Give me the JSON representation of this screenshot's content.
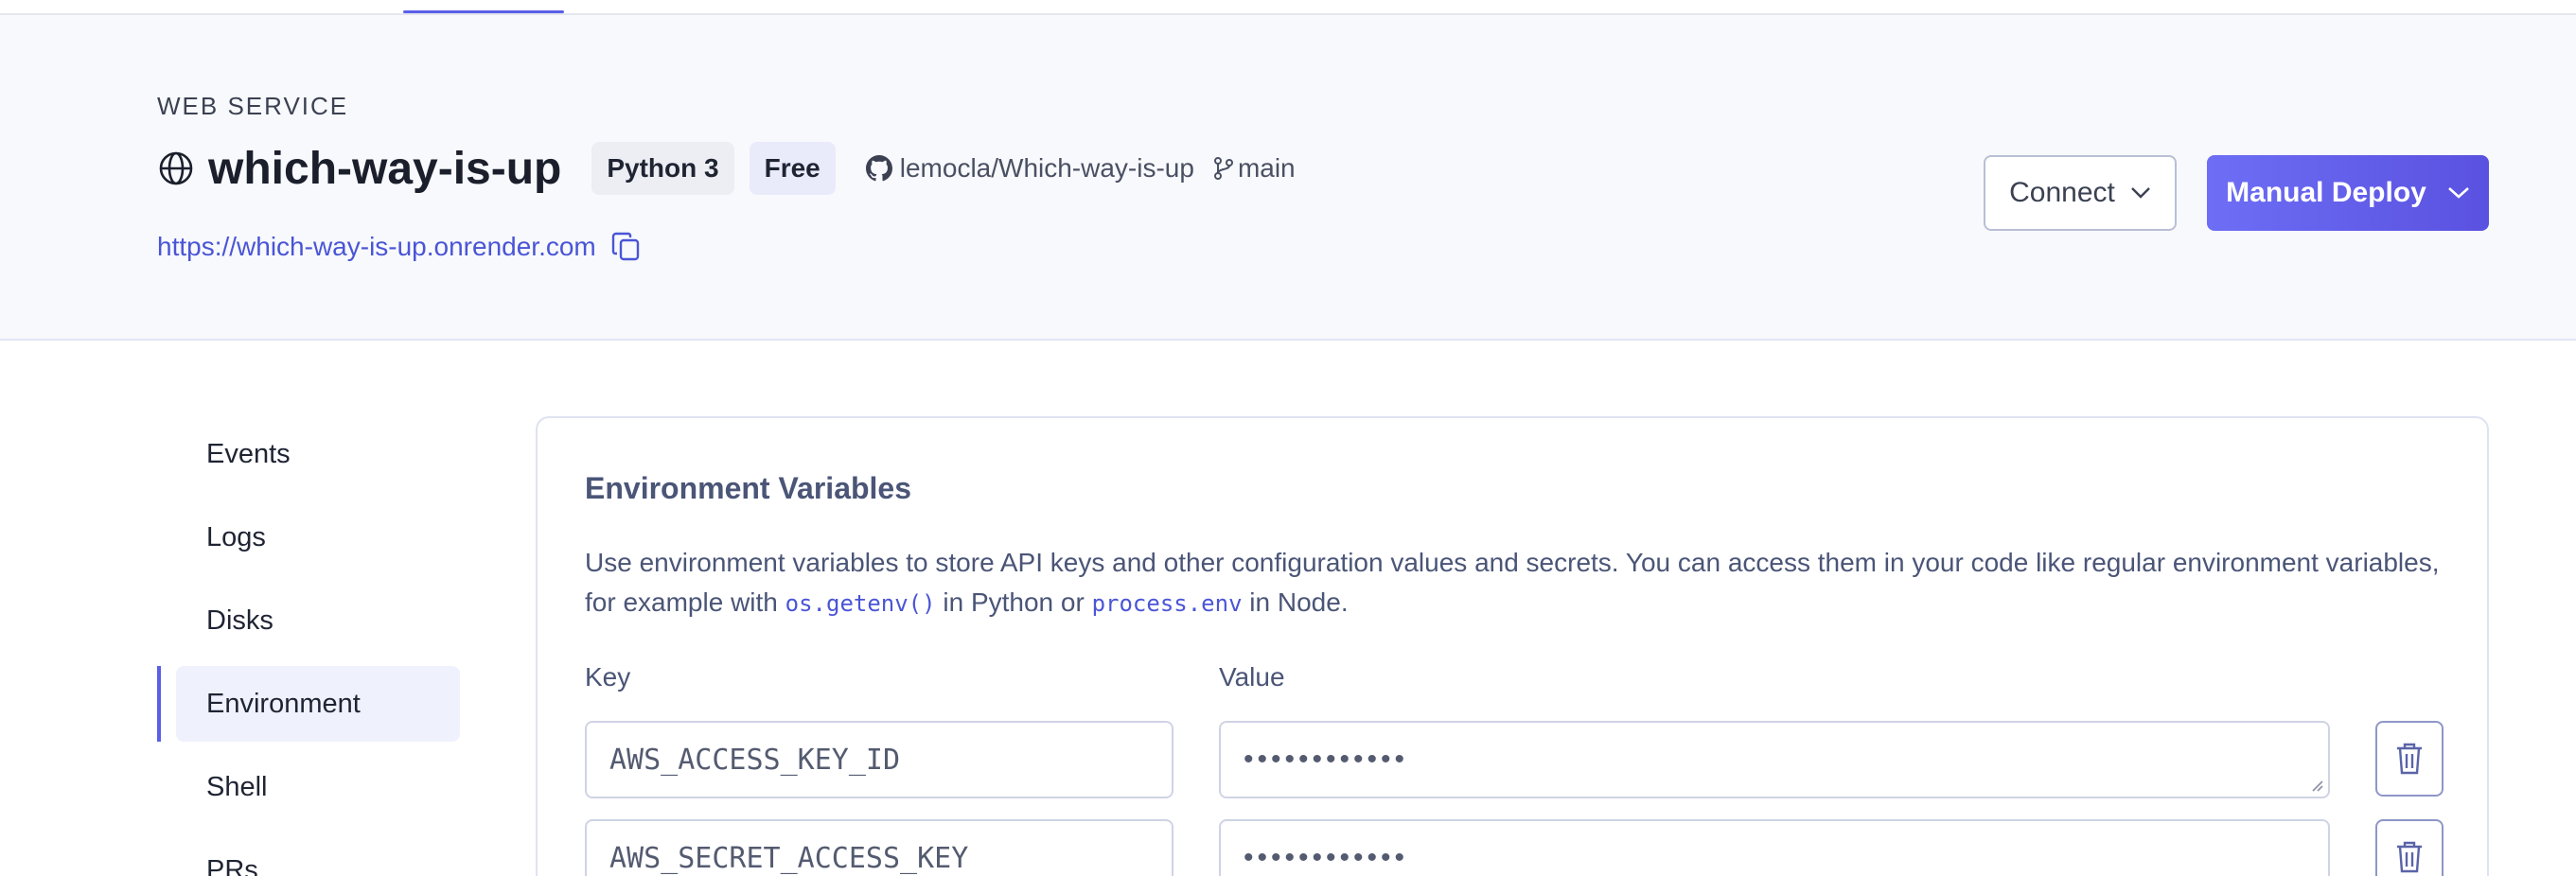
{
  "header": {
    "service_kind": "WEB SERVICE",
    "service_name": "which-way-is-up",
    "runtime_badge": "Python 3",
    "plan_badge": "Free",
    "repo": "lemocla/Which-way-is-up",
    "branch": "main",
    "url": "https://which-way-is-up.onrender.com",
    "connect_label": "Connect",
    "deploy_label": "Manual Deploy"
  },
  "sidebar": {
    "items": [
      {
        "label": "Events"
      },
      {
        "label": "Logs"
      },
      {
        "label": "Disks"
      },
      {
        "label": "Environment",
        "active": true
      },
      {
        "label": "Shell"
      },
      {
        "label": "PRs"
      }
    ]
  },
  "env": {
    "title": "Environment Variables",
    "desc_part1": "Use environment variables to store API keys and other configuration values and secrets. You can access them in your code like regular environment variables, for example with ",
    "desc_code1": "os.getenv()",
    "desc_part2": " in Python or ",
    "desc_code2": "process.env",
    "desc_part3": " in Node.",
    "key_label": "Key",
    "value_label": "Value",
    "rows": [
      {
        "key": "AWS_ACCESS_KEY_ID",
        "value": "••••••••••••"
      },
      {
        "key": "AWS_SECRET_ACCESS_KEY",
        "value": "••••••••••••"
      }
    ]
  },
  "colors": {
    "accent": "#5b5fe8",
    "header_bg": "#f8f9fc",
    "link": "#4a55d6"
  }
}
